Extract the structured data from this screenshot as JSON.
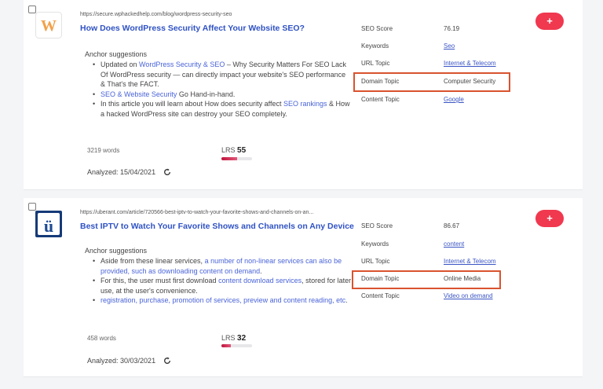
{
  "results": [
    {
      "url": "https://secure.wphackedhelp.com/blog/wordpress-security-seo",
      "title": "How Does WordPress Security Affect Your Website SEO?",
      "anchor_heading": "Anchor suggestions",
      "bullets": [
        {
          "text1": "Updated on ",
          "link1": "WordPress Security & SEO",
          "text2": " – Why Security Matters For SEO Lack Of WordPress security — can directly impact your website's SEO performance & That's the FACT."
        },
        {
          "text1": "",
          "link1": "SEO & Website Security",
          "text2": " Go Hand-in-hand."
        },
        {
          "text1": "In this article you will learn about How does security affect ",
          "link1": "SEO rankings",
          "text2": " & How a hacked WordPress site can destroy your SEO completely."
        }
      ],
      "words": "3219 words",
      "lrs_label": "LRS",
      "lrs_value": "55",
      "lrs_fill": 0.5,
      "analyzed": "Analyzed:  15/04/2021",
      "labels": {
        "seo_score": "SEO Score",
        "keywords": "Keywords",
        "url_topic": "URL Topic",
        "domain_topic": "Domain Topic",
        "content_topic": "Content Topic"
      },
      "seo_score": "76.19",
      "keywords": "Seo",
      "url_topic": "Internet & Telecom",
      "domain_topic": "Computer Security",
      "content_topic": "Google",
      "add_label": "+"
    },
    {
      "url": "https://uberant.com/article/720566-best-iptv-to-watch-your-favorite-shows-and-channels-on-an...",
      "title": "Best IPTV to Watch Your Favorite Shows and Channels on Any Device",
      "anchor_heading": "Anchor suggestions",
      "bullets": [
        {
          "text1": "Aside from these linear services, ",
          "link1": "a number of non-linear services can also be provided, such as downloading content on demand",
          "text2": "."
        },
        {
          "text1": "For this, the user must first download ",
          "link1": "content download services",
          "text2": ", stored for later use, at the user's convenience."
        },
        {
          "text1": "",
          "link1": "registration, purchase, promotion of services, preview and content reading, etc",
          "text2": "."
        }
      ],
      "words": "458 words",
      "lrs_label": "LRS",
      "lrs_value": "32",
      "lrs_fill": 0.3,
      "analyzed": "Analyzed:  30/03/2021",
      "labels": {
        "seo_score": "SEO Score",
        "keywords": "Keywords",
        "url_topic": "URL Topic",
        "domain_topic": "Domain Topic",
        "content_topic": "Content Topic"
      },
      "seo_score": "86.67",
      "keywords": "content",
      "url_topic": "Internet & Telecom",
      "domain_topic": "Online Media",
      "content_topic": "Video on demand",
      "add_label": "+"
    }
  ],
  "colors": {
    "accent": "#f0384f",
    "link": "#2f52c4",
    "highlight": "#d9532f",
    "lrs_bar": "#c0143c"
  }
}
